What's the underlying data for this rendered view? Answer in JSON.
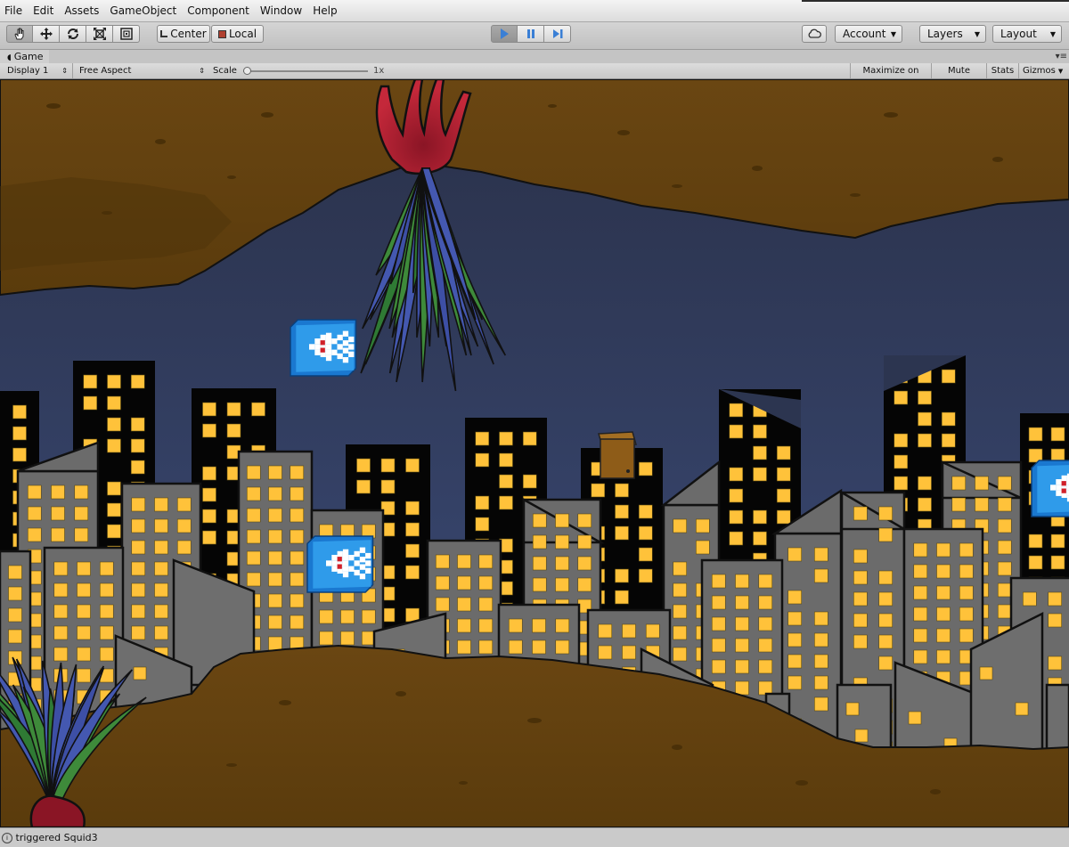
{
  "menubar": {
    "items": [
      "File",
      "Edit",
      "Assets",
      "GameObject",
      "Component",
      "Window",
      "Help"
    ]
  },
  "toolbar": {
    "tools": [
      "hand-icon",
      "move-icon",
      "rotate-icon",
      "scale-icon",
      "rect-tool-icon"
    ],
    "pivot_label": "Center",
    "space_label": "Local",
    "playback": [
      "play-icon",
      "pause-icon",
      "step-icon"
    ],
    "account_label": "Account",
    "layers_label": "Layers",
    "layout_label": "Layout",
    "accent_color": "#3a7fd5"
  },
  "game_tab": {
    "label": "Game"
  },
  "game_toolbar": {
    "display": "Display 1",
    "aspect": "Free Aspect",
    "scale_label": "Scale",
    "scale_value": "1x",
    "scale_level": 0.0,
    "maximize_label": "Maximize on Play",
    "mute_label": "Mute audio",
    "stats_label": "Stats",
    "gizmos_label": "Gizmos"
  },
  "status": {
    "icon": "info-icon",
    "message": "triggered Squid3"
  }
}
